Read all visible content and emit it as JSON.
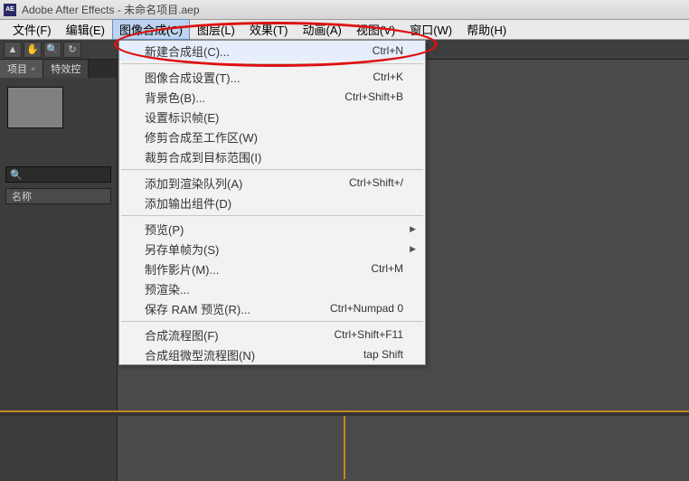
{
  "title": "Adobe After Effects - 未命名项目.aep",
  "app_icon": "AE",
  "menubar": [
    {
      "label": "文件(F)"
    },
    {
      "label": "编辑(E)"
    },
    {
      "label": "图像合成(C)",
      "active": true
    },
    {
      "label": "图层(L)"
    },
    {
      "label": "效果(T)"
    },
    {
      "label": "动画(A)"
    },
    {
      "label": "视图(V)"
    },
    {
      "label": "窗口(W)"
    },
    {
      "label": "帮助(H)"
    }
  ],
  "toolbar_icons": [
    "▲",
    "✋",
    "🔍",
    "↻"
  ],
  "panel": {
    "tab_project": "项目",
    "tab_effects": "特效控",
    "thumb_label": "",
    "search_placeholder": "",
    "col_name": "名称"
  },
  "dropdown": {
    "items": [
      {
        "label": "新建合成组(C)...",
        "shortcut": "Ctrl+N",
        "highlight": true
      },
      {
        "sep": true
      },
      {
        "label": "图像合成设置(T)...",
        "shortcut": "Ctrl+K"
      },
      {
        "label": "背景色(B)...",
        "shortcut": "Ctrl+Shift+B"
      },
      {
        "label": "设置标识帧(E)"
      },
      {
        "label": "修剪合成至工作区(W)"
      },
      {
        "label": "裁剪合成到目标范围(I)"
      },
      {
        "sep": true
      },
      {
        "label": "添加到渲染队列(A)",
        "shortcut": "Ctrl+Shift+/"
      },
      {
        "label": "添加输出组件(D)"
      },
      {
        "sep": true
      },
      {
        "label": "预览(P)",
        "submenu": true
      },
      {
        "label": "另存单帧为(S)",
        "submenu": true
      },
      {
        "label": "制作影片(M)...",
        "shortcut": "Ctrl+M"
      },
      {
        "label": "预渲染..."
      },
      {
        "label": "保存 RAM 预览(R)...",
        "shortcut": "Ctrl+Numpad 0"
      },
      {
        "sep": true
      },
      {
        "label": "合成流程图(F)",
        "shortcut": "Ctrl+Shift+F11"
      },
      {
        "label": "合成组微型流程图(N)",
        "shortcut": "tap Shift"
      }
    ]
  }
}
